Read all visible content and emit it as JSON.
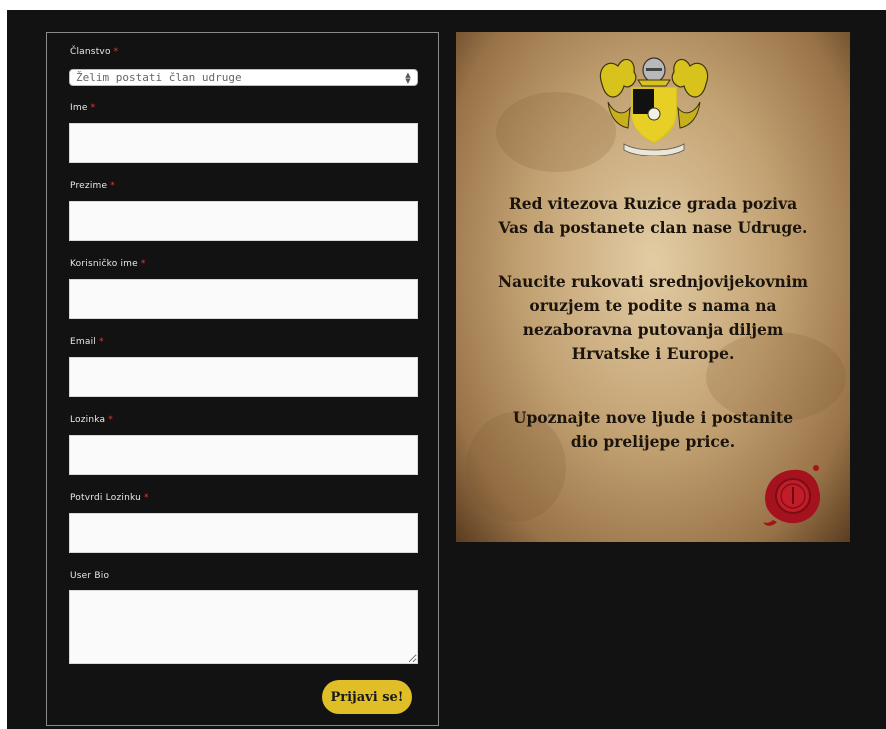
{
  "form": {
    "membership": {
      "label": "Članstvo",
      "required_mark": "*",
      "selected": "Želim postati član udruge"
    },
    "fields": [
      {
        "label": "Ime",
        "required_mark": "*",
        "value": ""
      },
      {
        "label": "Prezime",
        "required_mark": "*",
        "value": ""
      },
      {
        "label": "Korisničko ime",
        "required_mark": "*",
        "value": ""
      },
      {
        "label": "Email",
        "required_mark": "*",
        "value": ""
      },
      {
        "label": "Lozinka",
        "required_mark": "*",
        "value": ""
      },
      {
        "label": "Potvrdi Lozinku",
        "required_mark": "*",
        "value": ""
      }
    ],
    "bio": {
      "label": "User Bio",
      "value": ""
    },
    "submit_label": "Prijavi se!"
  },
  "poster": {
    "paragraph1": "Red vitezova Ruzice grada poziva\nVas da postanete clan nase Udruge.",
    "paragraph2": "Naucite rukovati srednjovijekovnim\noruzjem te podite s nama na\nnezaboravna putovanja diljem\nHrvatske i Europe.",
    "paragraph3": "Upoznajte nove ljude i postanite\ndio prelijepe price.",
    "crest_icon": "coat-of-arms-icon",
    "seal_icon": "wax-seal-icon"
  },
  "colors": {
    "background": "#121212",
    "accent_button": "#e0be28",
    "required": "#e23b3b"
  }
}
